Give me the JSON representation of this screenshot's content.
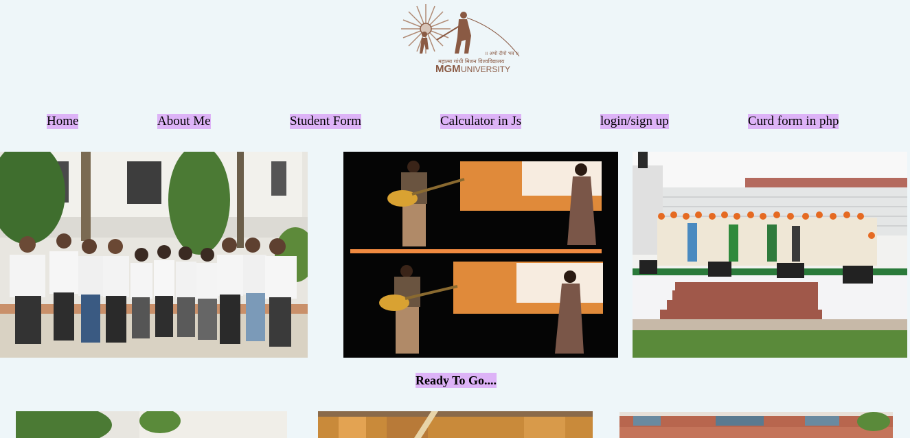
{
  "header": {
    "logo_tagline": "॥ अथो दीपो भव ॥",
    "logo_hindi": "महात्मा गांधी मिशन विश्वविद्यालय",
    "logo_brand": "MGM",
    "logo_university": "UNIVERSITY"
  },
  "nav": {
    "items": [
      {
        "label": "Home"
      },
      {
        "label": "About Me"
      },
      {
        "label": "Student Form"
      },
      {
        "label": "Calculator in Js"
      },
      {
        "label": "login/sign up"
      },
      {
        "label": "Curd form in php"
      }
    ]
  },
  "gallery": {
    "heading": "Ready To Go...."
  },
  "colors": {
    "page_background": "#eef6f9",
    "link_highlight": "#ddb3f7",
    "logo_brown": "#8a5a44"
  }
}
